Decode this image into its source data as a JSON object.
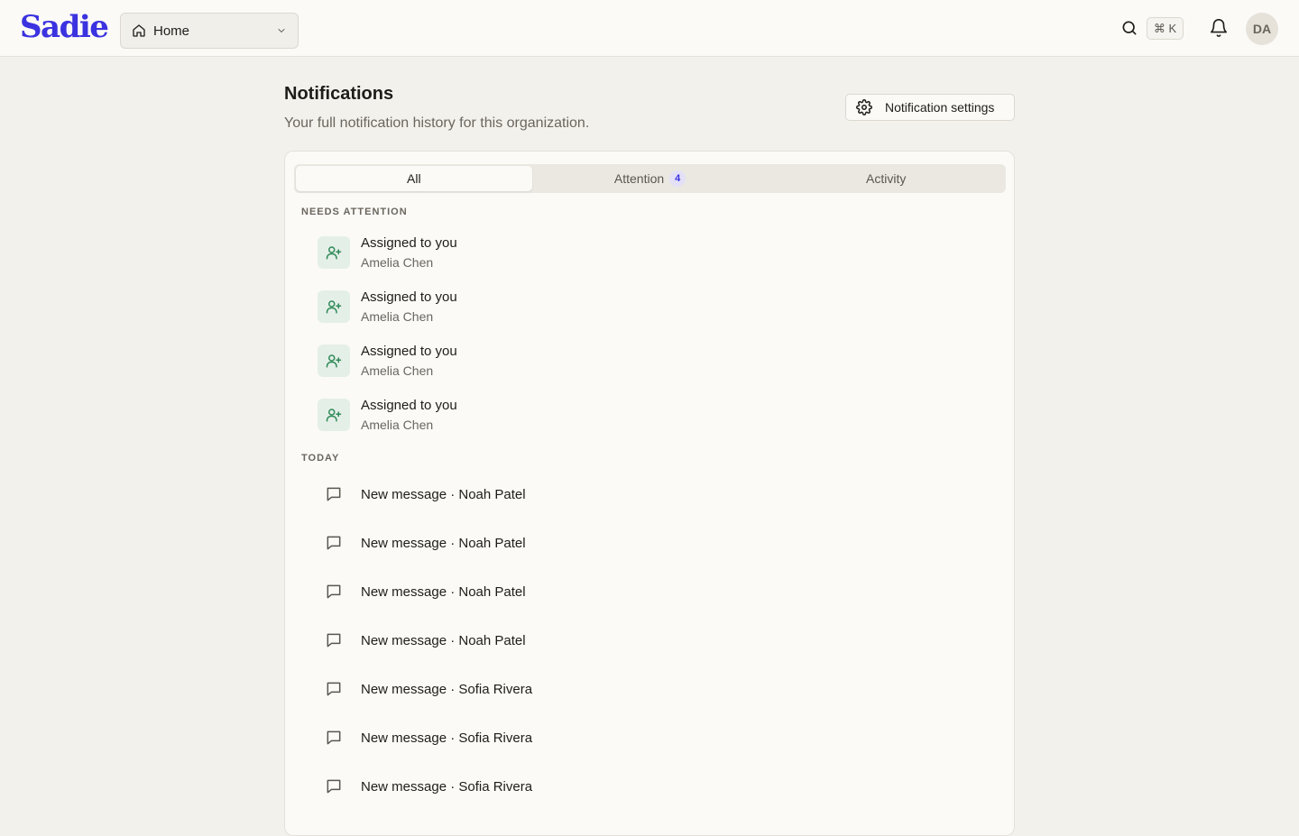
{
  "brand": {
    "logo": "Sadie",
    "color": "#3b32e0"
  },
  "header": {
    "workspace": "Home",
    "shortcut": "⌘ K",
    "avatar_initials": "DA"
  },
  "page": {
    "title": "Notifications",
    "subtitle": "Your full notification history for this organization.",
    "settings_label": "Notification settings"
  },
  "tabs": [
    {
      "label": "All",
      "active": true
    },
    {
      "label": "Attention",
      "count": "4"
    },
    {
      "label": "Activity"
    }
  ],
  "sections": {
    "attention_label": "NEEDS ATTENTION",
    "today_label": "TODAY"
  },
  "attention_items": [
    {
      "title": "Assigned to you",
      "sub": "Amelia Chen",
      "icon": "user-plus-icon"
    },
    {
      "title": "Assigned to you",
      "sub": "Amelia Chen",
      "icon": "user-plus-icon"
    },
    {
      "title": "Assigned to you",
      "sub": "Amelia Chen",
      "icon": "user-plus-icon"
    },
    {
      "title": "Assigned to you",
      "sub": "Amelia Chen",
      "icon": "user-plus-icon"
    }
  ],
  "today_items": [
    {
      "title": "New message · Noah Patel",
      "icon": "message-icon"
    },
    {
      "title": "New message · Noah Patel",
      "icon": "message-icon"
    },
    {
      "title": "New message · Noah Patel",
      "icon": "message-icon"
    },
    {
      "title": "New message · Noah Patel",
      "icon": "message-icon"
    },
    {
      "title": "New message · Sofia Rivera",
      "icon": "message-icon"
    },
    {
      "title": "New message · Sofia Rivera",
      "icon": "message-icon"
    },
    {
      "title": "New message · Sofia Rivera",
      "icon": "message-icon"
    }
  ]
}
